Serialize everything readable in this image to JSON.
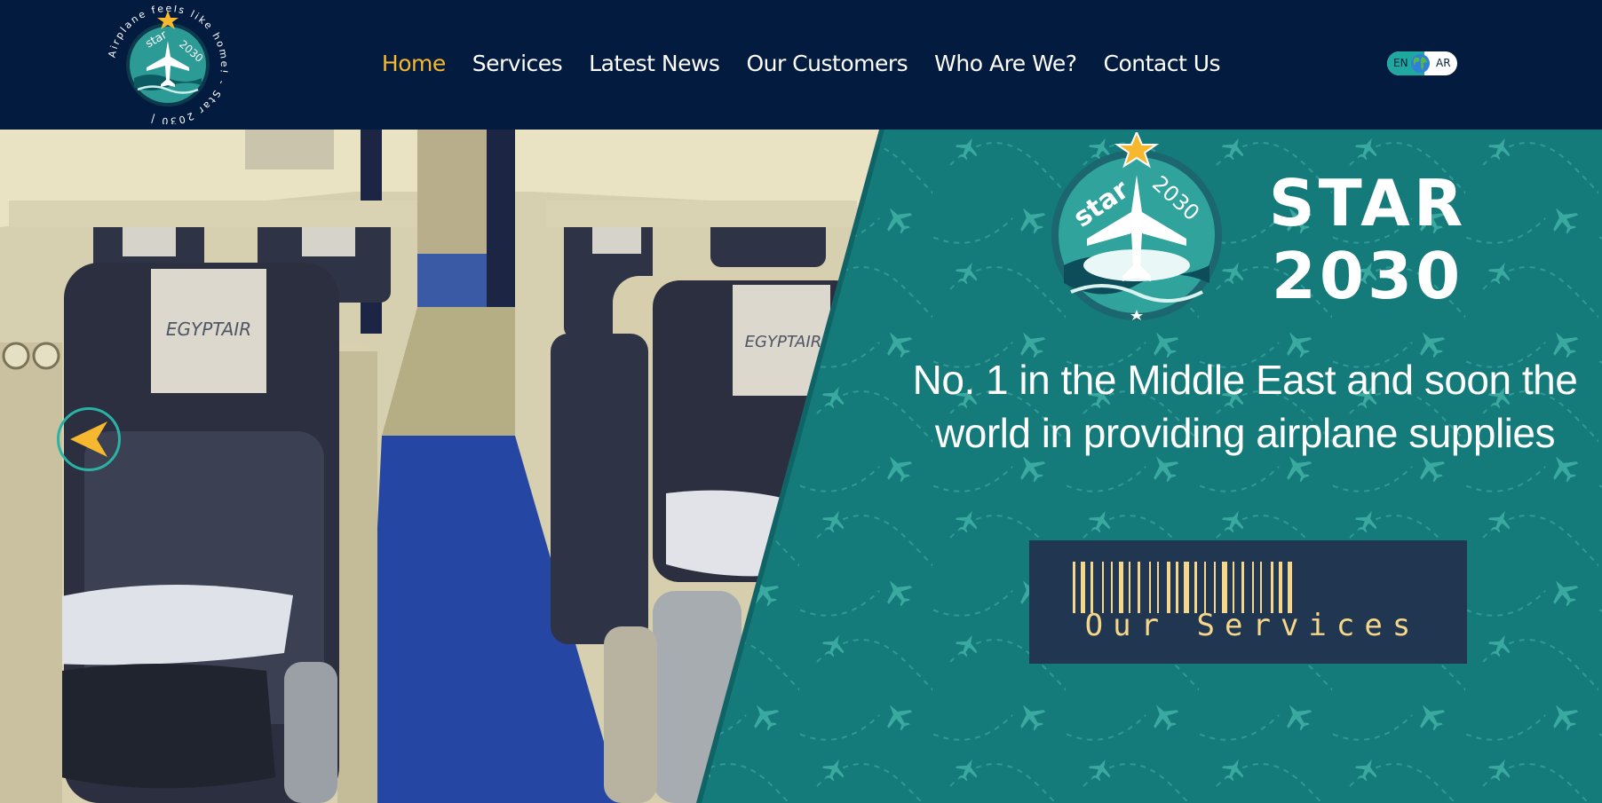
{
  "header": {
    "logo": {
      "name": "star-2030-logo",
      "ring_text": "Airplane feels like home! - Star 2030 |",
      "badge_text": "star 2030"
    },
    "nav": [
      {
        "label": "Home",
        "active": true
      },
      {
        "label": "Services",
        "active": false
      },
      {
        "label": "Latest News",
        "active": false
      },
      {
        "label": "Our Customers",
        "active": false
      },
      {
        "label": "Who Are We?",
        "active": false
      },
      {
        "label": "Contact Us",
        "active": false
      }
    ],
    "language": {
      "left": "EN",
      "right": "AR",
      "icon": "globe-icon"
    }
  },
  "hero": {
    "photo_icon": "egyptair-cabin-photo",
    "headrest_text": "EGYPTAIR",
    "logo_badge_text": "star 2030",
    "wordmark_line1": "STAR",
    "wordmark_line2": "2030",
    "tagline": "No. 1 in the Middle East and soon the world in providing airplane supplies",
    "cta_label": "Our Services",
    "prev_icon": "chevron-left-icon"
  },
  "colors": {
    "header_bg": "#021b3e",
    "accent": "#f5b82e",
    "teal": "#157a7a",
    "teal_light": "#2ab3a5",
    "cta_bg": "#203651",
    "cta_text": "#f6d78a"
  }
}
